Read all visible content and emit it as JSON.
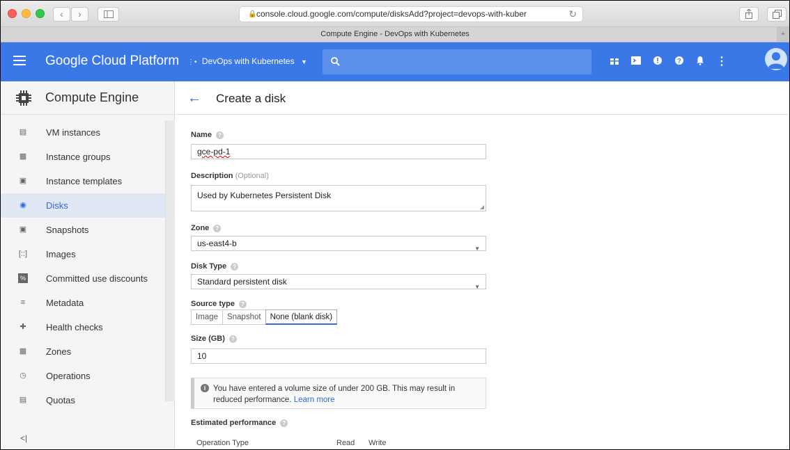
{
  "browser": {
    "url": "console.cloud.google.com/compute/disksAdd?project=devops-with-kuber",
    "tab_title": "Compute Engine - DevOps with Kubernetes"
  },
  "header": {
    "brand": "Google Cloud Platform",
    "project": "DevOps with Kubernetes",
    "accent": "#3b78e7"
  },
  "sidebar": {
    "title": "Compute Engine",
    "items": [
      {
        "label": "VM instances",
        "icon": "vm-instances-icon"
      },
      {
        "label": "Instance groups",
        "icon": "instance-groups-icon"
      },
      {
        "label": "Instance templates",
        "icon": "instance-templates-icon"
      },
      {
        "label": "Disks",
        "icon": "disks-icon",
        "active": true
      },
      {
        "label": "Snapshots",
        "icon": "snapshots-icon"
      },
      {
        "label": "Images",
        "icon": "images-icon"
      },
      {
        "label": "Committed use discounts",
        "icon": "discount-icon"
      },
      {
        "label": "Metadata",
        "icon": "metadata-icon"
      },
      {
        "label": "Health checks",
        "icon": "health-checks-icon"
      },
      {
        "label": "Zones",
        "icon": "zones-icon"
      },
      {
        "label": "Operations",
        "icon": "operations-icon"
      },
      {
        "label": "Quotas",
        "icon": "quotas-icon"
      }
    ],
    "collapse": "<|"
  },
  "page": {
    "title": "Create a disk",
    "name_label": "Name",
    "name_value": "gce-pd-1",
    "description_label": "Description",
    "description_optional": "(Optional)",
    "description_value": "Used by Kubernetes Persistent Disk",
    "zone_label": "Zone",
    "zone_value": "us-east4-b",
    "disk_type_label": "Disk Type",
    "disk_type_value": "Standard persistent disk",
    "source_type_label": "Source type",
    "source_options": [
      "Image",
      "Snapshot",
      "None (blank disk)"
    ],
    "source_selected": "None (blank disk)",
    "size_label": "Size (GB)",
    "size_value": "10",
    "notice_text": "You have entered a volume size of under 200 GB. This may result in reduced performance.",
    "notice_link": "Learn more",
    "perf_title": "Estimated performance",
    "perf_columns": [
      "Operation Type",
      "Read",
      "Write"
    ]
  }
}
